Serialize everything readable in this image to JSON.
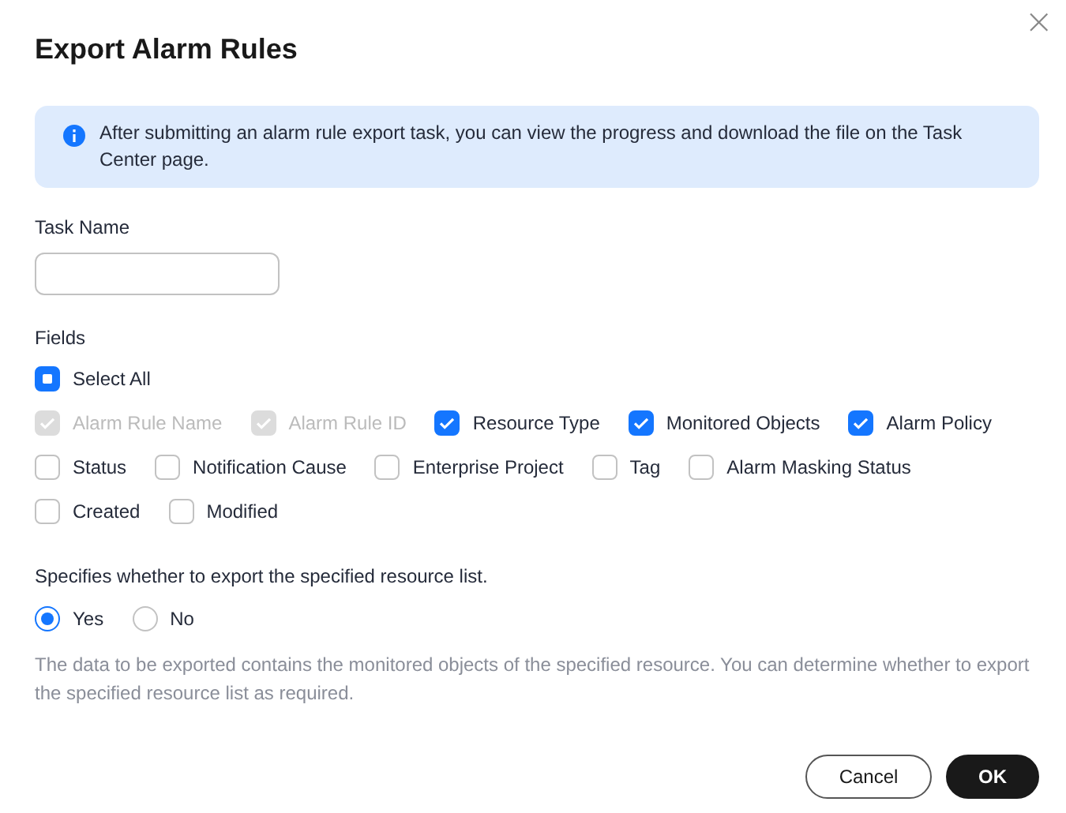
{
  "dialog": {
    "title": "Export Alarm Rules",
    "close": "×"
  },
  "notice": "After submitting an alarm rule export task, you can view the progress and download the file on the Task Center page.",
  "task_name": {
    "label": "Task Name"
  },
  "fields": {
    "label": "Fields",
    "select_all": {
      "label": "Select All",
      "indeterminate": true
    },
    "items": [
      {
        "label": "Alarm Rule Name",
        "checked": true,
        "disabled": true
      },
      {
        "label": "Alarm Rule ID",
        "checked": true,
        "disabled": true
      },
      {
        "label": "Resource Type",
        "checked": true,
        "disabled": false
      },
      {
        "label": "Monitored Objects",
        "checked": true,
        "disabled": false
      },
      {
        "label": "Alarm Policy",
        "checked": true,
        "disabled": false
      },
      {
        "label": "Status",
        "checked": false,
        "disabled": false
      },
      {
        "label": "Notification Cause",
        "checked": false,
        "disabled": false
      },
      {
        "label": "Enterprise Project",
        "checked": false,
        "disabled": false
      },
      {
        "label": "Tag",
        "checked": false,
        "disabled": false
      },
      {
        "label": "Alarm Masking Status",
        "checked": false,
        "disabled": false
      },
      {
        "label": "Created",
        "checked": false,
        "disabled": false
      },
      {
        "label": "Modified",
        "checked": false,
        "disabled": false
      }
    ]
  },
  "resource_list": {
    "question": "Specifies whether to export the specified resource list.",
    "options": [
      {
        "label": "Yes",
        "selected": true
      },
      {
        "label": "No",
        "selected": false
      }
    ],
    "description": "The data to be exported contains the monitored objects of the specified resource. You can determine whether to export the specified resource list as required."
  },
  "buttons": [
    {
      "label": "Cancel",
      "kind": "secondary"
    },
    {
      "label": "OK",
      "kind": "primary"
    }
  ]
}
